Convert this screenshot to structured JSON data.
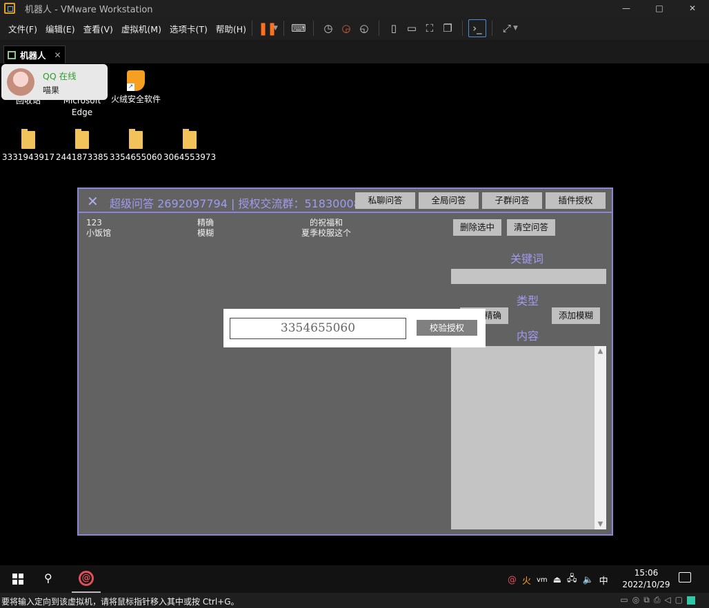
{
  "window": {
    "title": "机器人 - VMware Workstation",
    "minimize": "—",
    "maximize": "□",
    "close": "✕"
  },
  "menu": {
    "items": [
      "文件(F)",
      "编辑(E)",
      "查看(V)",
      "虚拟机(M)",
      "选项卡(T)",
      "帮助(H)"
    ]
  },
  "toolbar": {
    "icons": [
      "pause-icon",
      "send-keys-icon",
      "snapshot-icon",
      "revert-snapshot-icon",
      "snapshot-manager-icon",
      "library-icon",
      "thumbnail-icon",
      "fullscreen-icon",
      "unity-icon",
      "console-icon",
      "stretch-icon"
    ],
    "pause_glyph": "❚❚"
  },
  "tab": {
    "label": "机器人",
    "close": "✕"
  },
  "desktop": {
    "icons": [
      {
        "label": "回收站"
      },
      {
        "label": "Microsoft Edge"
      },
      {
        "label": "火绒安全软件"
      }
    ],
    "folders": [
      "3331943917",
      "2441873385",
      "3354655060",
      "3064553973"
    ]
  },
  "qq_popup": {
    "status": "QQ 在线",
    "nickname": "喵果"
  },
  "plugin": {
    "close": "✕",
    "title": "超级问答  2692097794 | 授权交流群：518300085",
    "tabs": [
      "私聊问答",
      "全局问答",
      "子群问答",
      "插件授权"
    ],
    "list": {
      "keywords": [
        "123",
        "小饭馆"
      ],
      "types": [
        "精确",
        "模糊"
      ],
      "contents": [
        "的祝福和",
        "夏季校服这个"
      ]
    },
    "delete_selected": "删除选中",
    "clear_qa": "清空问答",
    "keyword_label": "关键词",
    "type_label": "类型",
    "add_exact": "添加精确",
    "add_fuzzy": "添加模糊",
    "content_label": "内容"
  },
  "auth_dialog": {
    "value": "3354655060",
    "button": "校验授权"
  },
  "taskbar": {
    "tray": [
      "@",
      "火",
      "vm",
      "⏏",
      "🖧",
      "🔈",
      "中"
    ],
    "time": "15:06",
    "date": "2022/10/29"
  },
  "statusbar": {
    "message": "要将输入定向到该虚拟机，请将鼠标指针移入其中或按 Ctrl+G。"
  }
}
